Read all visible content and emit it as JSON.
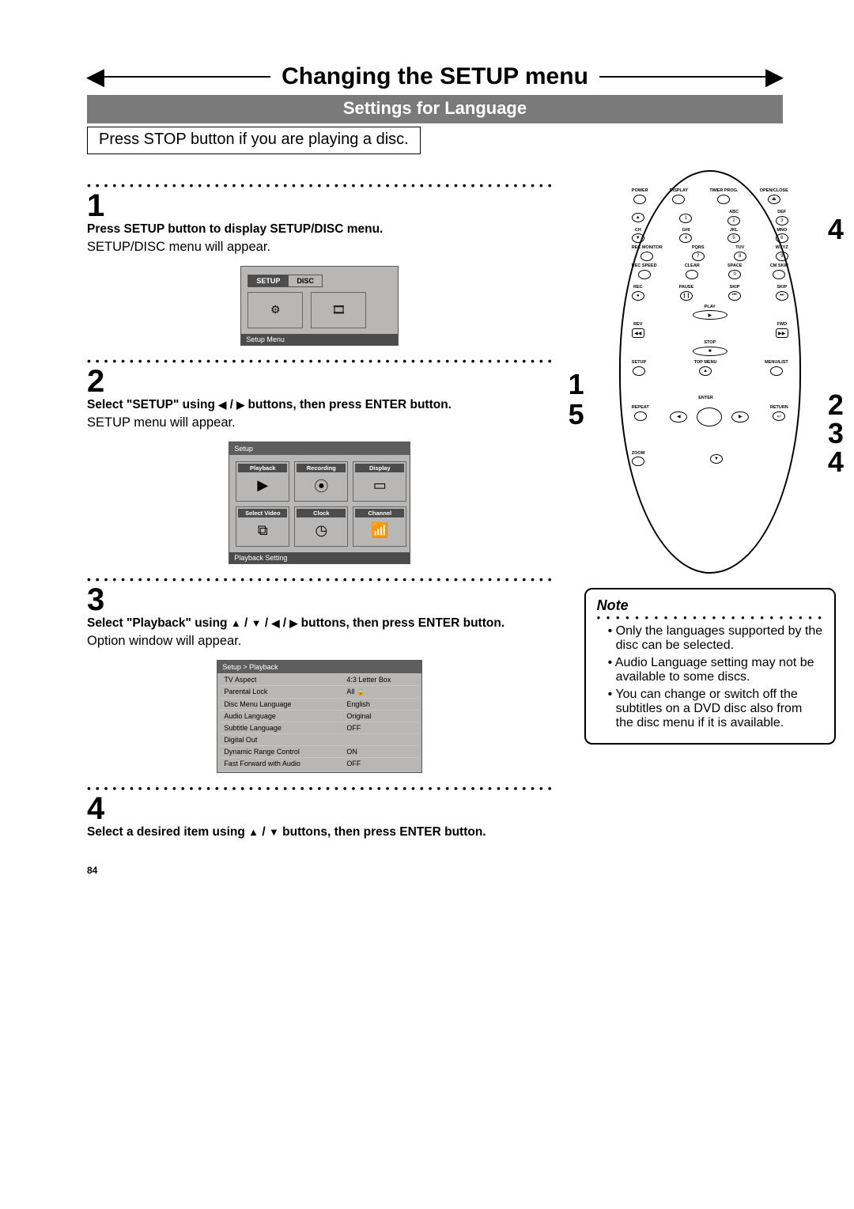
{
  "page": {
    "title": "Changing the SETUP menu",
    "subtitle": "Settings for Language",
    "intro": "Press STOP button if you are playing a disc.",
    "page_number": "84"
  },
  "steps": {
    "s1": {
      "num": "1",
      "bold": "Press SETUP button to display SETUP/DISC menu.",
      "plain": "SETUP/DISC menu will appear."
    },
    "s2": {
      "num": "2",
      "bold_a": "Select \"SETUP\" using ",
      "bold_b": " / ",
      "bold_c": " buttons, then press ENTER button.",
      "plain": "SETUP menu will appear."
    },
    "s3": {
      "num": "3",
      "bold_a": "Select \"Playback\" using ",
      "bold_b": " / ",
      "bold_c": " / ",
      "bold_d": " / ",
      "bold_e": " buttons, then press ENTER button.",
      "plain": "Option window will appear."
    },
    "s4": {
      "num": "4",
      "bold_a": "Select a desired item using ",
      "bold_b": " / ",
      "bold_c": " buttons, then press ENTER button."
    }
  },
  "screens": {
    "s1": {
      "tab_setup": "SETUP",
      "tab_disc": "DISC",
      "footer": "Setup Menu"
    },
    "s2": {
      "bar": "Setup",
      "cells": [
        "Playback",
        "Recording",
        "Display",
        "Select Video",
        "Clock",
        "Channel"
      ],
      "footer": "Playback Setting"
    },
    "s3": {
      "bar": "Setup > Playback",
      "rows": [
        [
          "TV Aspect",
          "4:3 Letter Box"
        ],
        [
          "Parental Lock",
          "All   🔒"
        ],
        [
          "Disc Menu Language",
          "English"
        ],
        [
          "Audio Language",
          "Original"
        ],
        [
          "Subtitle Language",
          "OFF"
        ],
        [
          "Digital Out",
          ""
        ],
        [
          "Dynamic Range Control",
          "ON"
        ],
        [
          "Fast Forward with Audio",
          "OFF"
        ]
      ]
    }
  },
  "remote": {
    "top_row": [
      "POWER",
      "DISPLAY",
      "TIMER PROG.",
      "OPEN/CLOSE"
    ],
    "num_labels_r1": [
      "",
      "ABC",
      "DEF"
    ],
    "num_labels_r2": [
      "GHI",
      "JKL",
      "MNO"
    ],
    "num_labels_r3": [
      "PQRS",
      "TUV",
      "WXYZ"
    ],
    "side_left": [
      "CH",
      "REC MONITOR",
      "REC SPEED"
    ],
    "row_clear": [
      "CLEAR",
      "SPACE",
      "CM SKIP"
    ],
    "row_rec": [
      "REC",
      "PAUSE",
      "SKIP",
      "SKIP"
    ],
    "play": "PLAY",
    "rev": "REV",
    "fwd": "FWD",
    "stop": "STOP",
    "row_setup": [
      "SETUP",
      "TOP MENU",
      "MENU/LIST"
    ],
    "row_repeat": [
      "REPEAT",
      "ENTER"
    ],
    "row_zoom": [
      "ZOOM",
      "RETURN"
    ]
  },
  "callouts": {
    "left15": [
      "1",
      "5"
    ],
    "right4": "4",
    "right234": [
      "2",
      "3",
      "4"
    ]
  },
  "note": {
    "hdr": "Note",
    "items": [
      "Only the languages supported by the disc can be selected.",
      "Audio Language setting may not be available to some discs.",
      "You can change or switch off the subtitles on a DVD disc also from the disc menu if it is available."
    ]
  }
}
